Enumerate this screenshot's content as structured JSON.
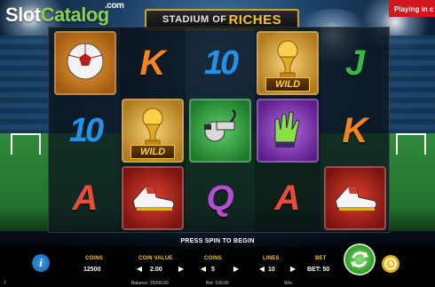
{
  "watermark": {
    "part1": "Slot",
    "part2": "Catalog",
    "suffix": ".com"
  },
  "title": {
    "part1": "STADIUM OF",
    "part2": "RICHES"
  },
  "banner": "Playing in c",
  "reels": [
    [
      {
        "type": "tile",
        "tile": "orange",
        "icon": "football-icon"
      },
      {
        "type": "ten",
        "text": "10"
      },
      {
        "type": "letter",
        "text": "A",
        "cls": "a2"
      }
    ],
    [
      {
        "type": "letter",
        "text": "K",
        "cls": "k"
      },
      {
        "type": "wild",
        "tile": "gold",
        "icon": "trophy-icon",
        "label": "WILD"
      },
      {
        "type": "tile",
        "tile": "red",
        "icon": "boot-icon"
      }
    ],
    [
      {
        "type": "ten",
        "text": "10"
      },
      {
        "type": "tile",
        "tile": "green",
        "icon": "whistle-icon"
      },
      {
        "type": "letter",
        "text": "Q",
        "cls": "q"
      }
    ],
    [
      {
        "type": "wild",
        "tile": "gold",
        "icon": "trophy-icon",
        "label": "WILD"
      },
      {
        "type": "tile",
        "tile": "purple",
        "icon": "gloves-icon"
      },
      {
        "type": "letter",
        "text": "A",
        "cls": "a2"
      }
    ],
    [
      {
        "type": "letter",
        "text": "J",
        "cls": "j"
      },
      {
        "type": "letter",
        "text": "K",
        "cls": "k"
      },
      {
        "type": "tile",
        "tile": "red",
        "icon": "boot-icon"
      }
    ]
  ],
  "press_spin": "PRESS SPIN TO BEGIN",
  "controls": {
    "coins_label": "COINS",
    "coins_value": "12500",
    "coin_value_label": "COIN VALUE",
    "coin_value": "2.00",
    "coins2_label": "COINS",
    "coins2_value": "5",
    "lines_label": "LINES",
    "lines_value": "10",
    "bet_label": "BET",
    "bet_value": "BET: 50"
  },
  "status": {
    "left": "7",
    "balance": "Balance: 25000.00",
    "bet": "Bet: 100.00",
    "win": "Win:"
  }
}
